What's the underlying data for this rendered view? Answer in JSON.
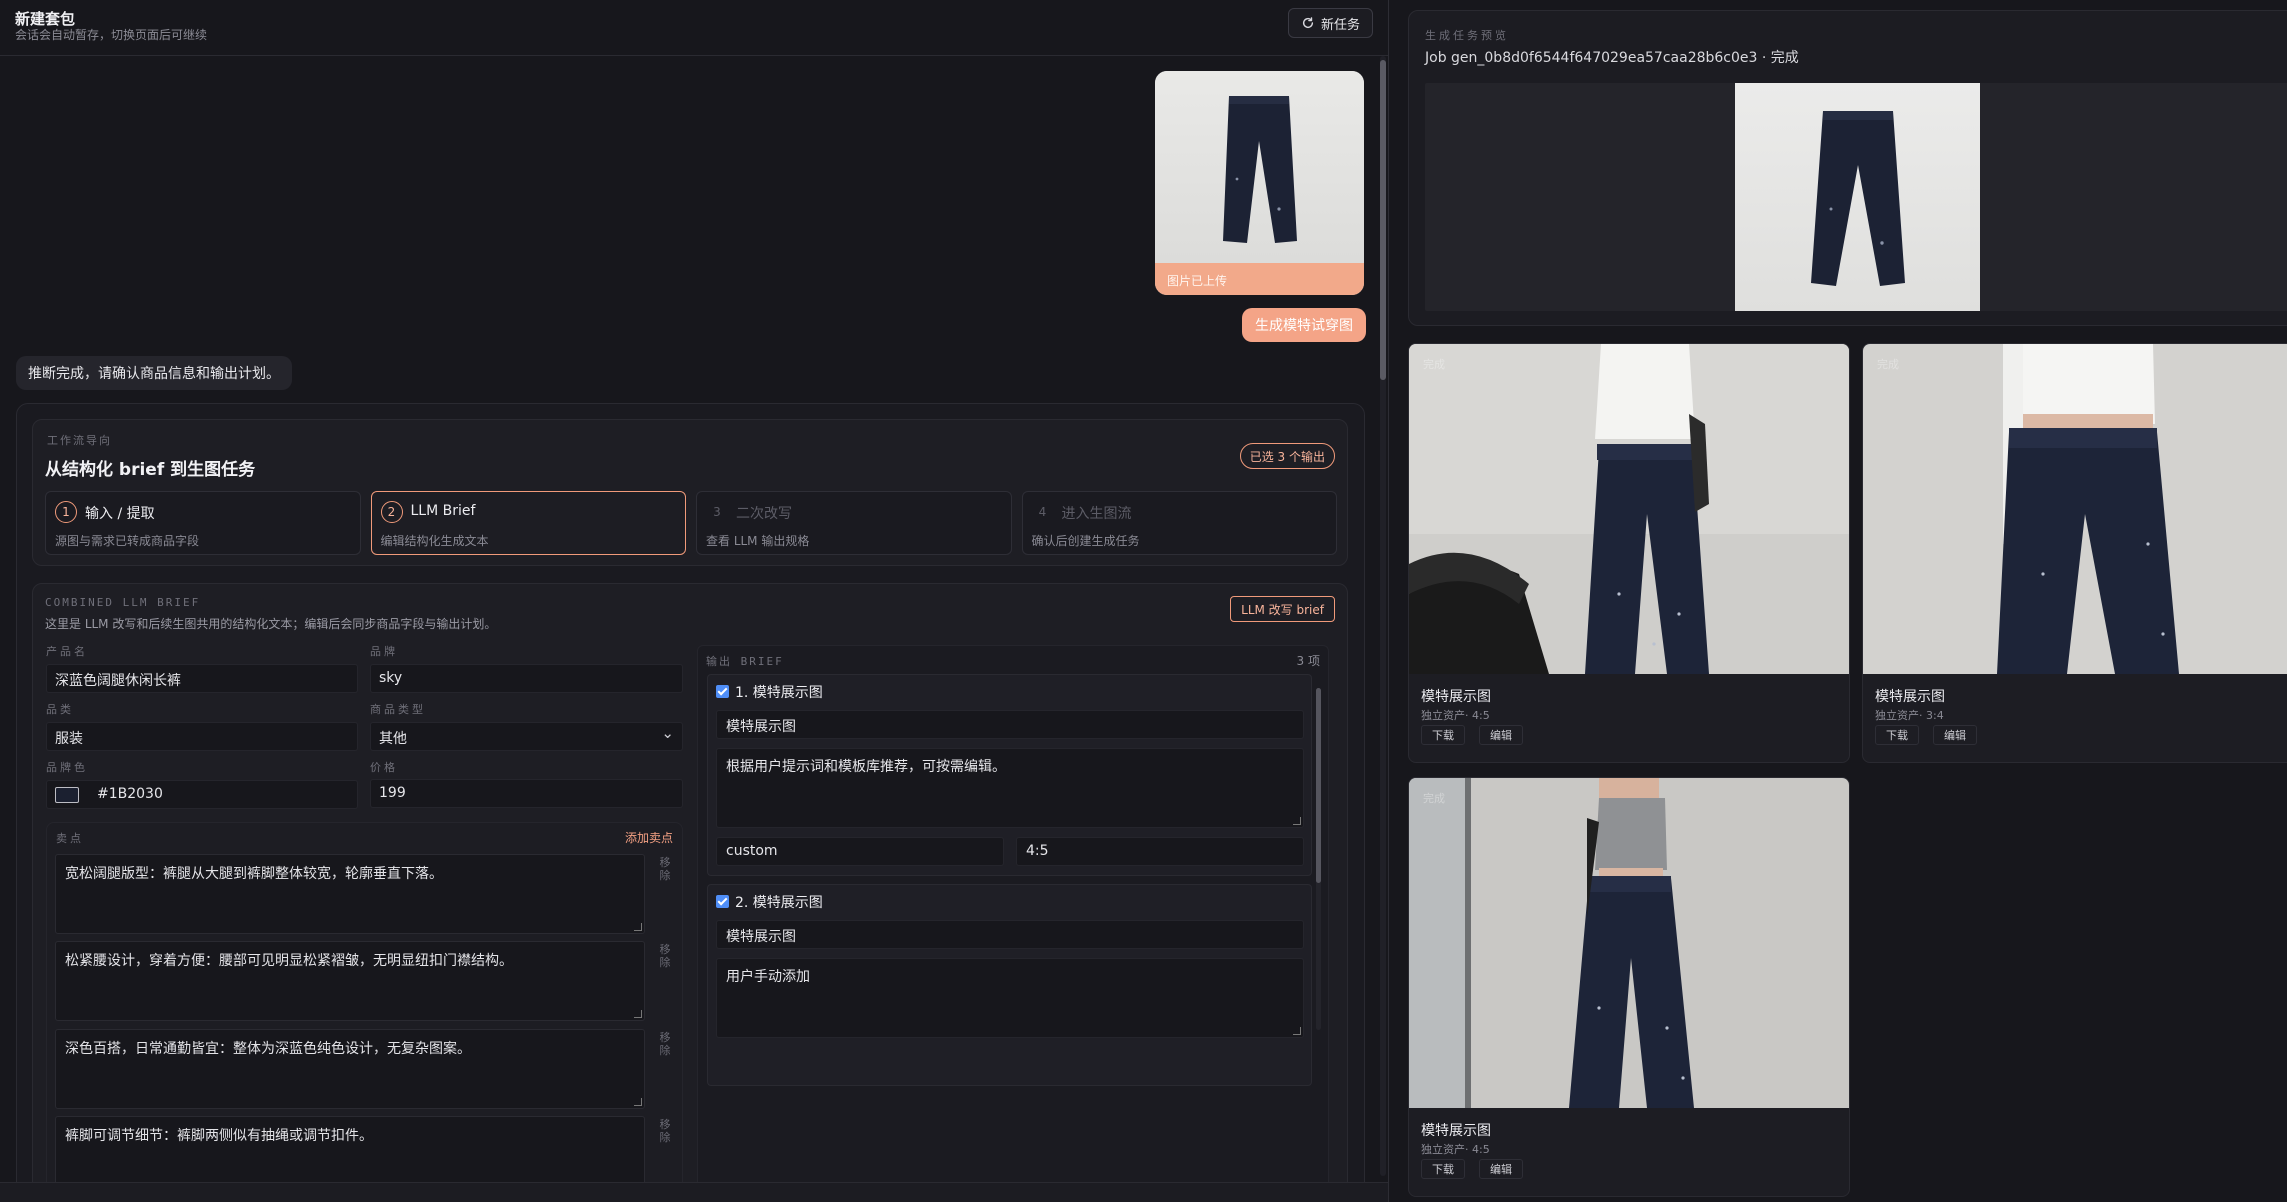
{
  "topbar": {
    "title": "新建套包",
    "subtitle": "会话会自动暂存，切换页面后可继续",
    "new_task": "新任务"
  },
  "upload": {
    "status": "图片已上传",
    "cta": "生成模特试穿图"
  },
  "chat": {
    "message": "推断完成，请确认商品信息和输出计划。"
  },
  "workflow": {
    "kicker": "工作流导向",
    "title": "从结构化 brief 到生图任务",
    "badge": "已选 3 个输出",
    "steps": [
      {
        "num": "1",
        "label": "输入 / 提取",
        "desc": "源图与需求已转成商品字段"
      },
      {
        "num": "2",
        "label": "LLM Brief",
        "desc": "编辑结构化生成文本"
      },
      {
        "num": "3",
        "label": "二次改写",
        "desc": "查看 LLM 输出规格"
      },
      {
        "num": "4",
        "label": "进入生图流",
        "desc": "确认后创建生成任务"
      }
    ]
  },
  "brief": {
    "kicker": "COMBINED LLM BRIEF",
    "desc": "这里是 LLM 改写和后续生图共用的结构化文本；编辑后会同步商品字段与输出计划。",
    "rewrite_button": "LLM 改写 brief",
    "product_name_label": "产品名",
    "product_name": "深蓝色阔腿休闲长裤",
    "brand_label": "品牌",
    "brand": "sky",
    "category_label": "品类",
    "category": "服装",
    "product_type_label": "商品类型",
    "product_type": "其他",
    "brand_color_label": "品牌色",
    "brand_color": "#1B2030",
    "price_label": "价格",
    "price": "199",
    "selling_points_label": "卖点",
    "add_selling_point": "添加卖点",
    "remove_label": "移除",
    "selling_points": [
      "宽松阔腿版型：裤腿从大腿到裤脚整体较宽，轮廓垂直下落。",
      "松紧腰设计，穿着方便：腰部可见明显松紧褶皱，无明显纽扣门襟结构。",
      "深色百搭，日常通勤皆宜：整体为深蓝色纯色设计，无复杂图案。",
      "裤脚可调节细节：裤脚两侧似有抽绳或调节扣件。"
    ]
  },
  "outputs": {
    "header": "输出 BRIEF",
    "count": "3 项",
    "items": [
      {
        "title": "1. 模特展示图",
        "name": "模特展示图",
        "prompt": "根据用户提示词和模板库推荐，可按需编辑。",
        "mode": "custom",
        "ratio": "4:5"
      },
      {
        "title": "2. 模特展示图",
        "name": "模特展示图",
        "prompt": "用户手动添加"
      }
    ]
  },
  "preview": {
    "kicker": "生成任务预览",
    "job": "Job gen_0b8d0f6544f647029ea57caa28b6c0e3 · 完成"
  },
  "results": [
    {
      "tag": "完成",
      "title": "模特展示图",
      "meta": "独立资产· 4:5",
      "download": "下载",
      "edit": "编辑"
    },
    {
      "tag": "完成",
      "title": "模特展示图",
      "meta": "独立资产· 3:4",
      "download": "下载",
      "edit": "编辑"
    },
    {
      "tag": "完成",
      "title": "模特展示图",
      "meta": "独立资产· 4:5",
      "download": "下载",
      "edit": "编辑"
    }
  ]
}
